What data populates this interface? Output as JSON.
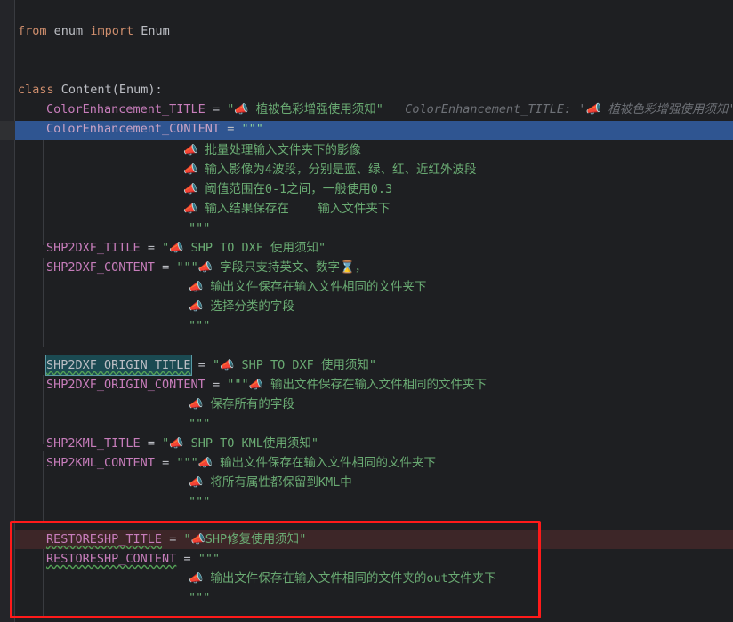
{
  "app": {
    "kind": "code-editor",
    "language": "Python",
    "theme": "dark",
    "colors": {
      "background": "#1e1f22",
      "gutter": "#242529",
      "caret_line": "#2f5591",
      "error_line": "#3d2628",
      "keyword": "#cf8e6d",
      "string": "#6aab73",
      "identifier": "#bcbec4",
      "field": "#c77dbb",
      "number": "#2aacb8",
      "inlay_hint": "#6e7177",
      "selection_teal": "#1b4a52",
      "squiggly": "#54a157",
      "annotation_red": "#ff1a1a",
      "indent_guide": "#393b40"
    }
  },
  "annotation": {
    "shape": "rectangle",
    "color": "#ff1a1a",
    "encloses": "RESTORESHP_TITLE and RESTORESHP_CONTENT block"
  },
  "icons": {
    "megaphone": "📣",
    "hourglass": "⌛"
  },
  "code": {
    "line_01": {
      "kw_from": "from",
      "mod": "enum",
      "kw_import": "import",
      "name": "Enum"
    },
    "line_04": {
      "kw_class": "class",
      "name": "Content",
      "base_open": "(",
      "base": "Enum",
      "base_close": ")",
      "colon": ":"
    },
    "color_enhancement": {
      "title_name": "ColorEnhancement_TITLE",
      "eq": "=",
      "title_quote": "\"",
      "title_value": "植被色彩增强使用须知",
      "inlay_hint": "ColorEnhancement_TITLE: '📣 植被色彩增强使用须知'",
      "content_name": "ColorEnhancement_CONTENT",
      "triple_quote": "\"\"\"",
      "content_lines": [
        "批量处理输入文件夹下的影像",
        "输入影像为4波段，分别是蓝、绿、红、近红外波段",
        "阈值范围在0-1之间，一般使用0.3",
        "输入结果保存在    输入文件夹下"
      ]
    },
    "shp2dxf": {
      "title_name": "SHP2DXF_TITLE",
      "title_value": "SHP TO DXF 使用须知",
      "content_name": "SHP2DXF_CONTENT",
      "content_lines": [
        "字段只支持英文、数字⌛，",
        "输出文件保存在输入文件相同的文件夹下",
        "选择分类的字段"
      ]
    },
    "shp2dxf_origin": {
      "title_name": "SHP2DXF_ORIGIN_TITLE",
      "title_selected": true,
      "title_value": "SHP TO DXF 使用须知",
      "content_name": "SHP2DXF_ORIGIN_CONTENT",
      "content_lines": [
        "输出文件保存在输入文件相同的文件夹下",
        "保存所有的字段"
      ]
    },
    "shp2kml": {
      "title_name": "SHP2KML_TITLE",
      "title_value": "SHP TO KML使用须知",
      "content_name": "SHP2KML_CONTENT",
      "content_lines": [
        "输出文件保存在输入文件相同的文件夹下",
        "将所有属性都保留到KML中"
      ]
    },
    "restoreshp": {
      "title_name": "RESTORESHP_TITLE",
      "title_has_warning": true,
      "title_value": "SHP修复使用须知",
      "content_name": "RESTORESHP_CONTENT",
      "content_has_warning": true,
      "content_lines": [
        "输出文件保存在输入文件相同的文件夹的out文件夹下"
      ]
    },
    "symbols": {
      "eq": "=",
      "quote": "\"",
      "triple_quote": "\"\"\""
    }
  }
}
